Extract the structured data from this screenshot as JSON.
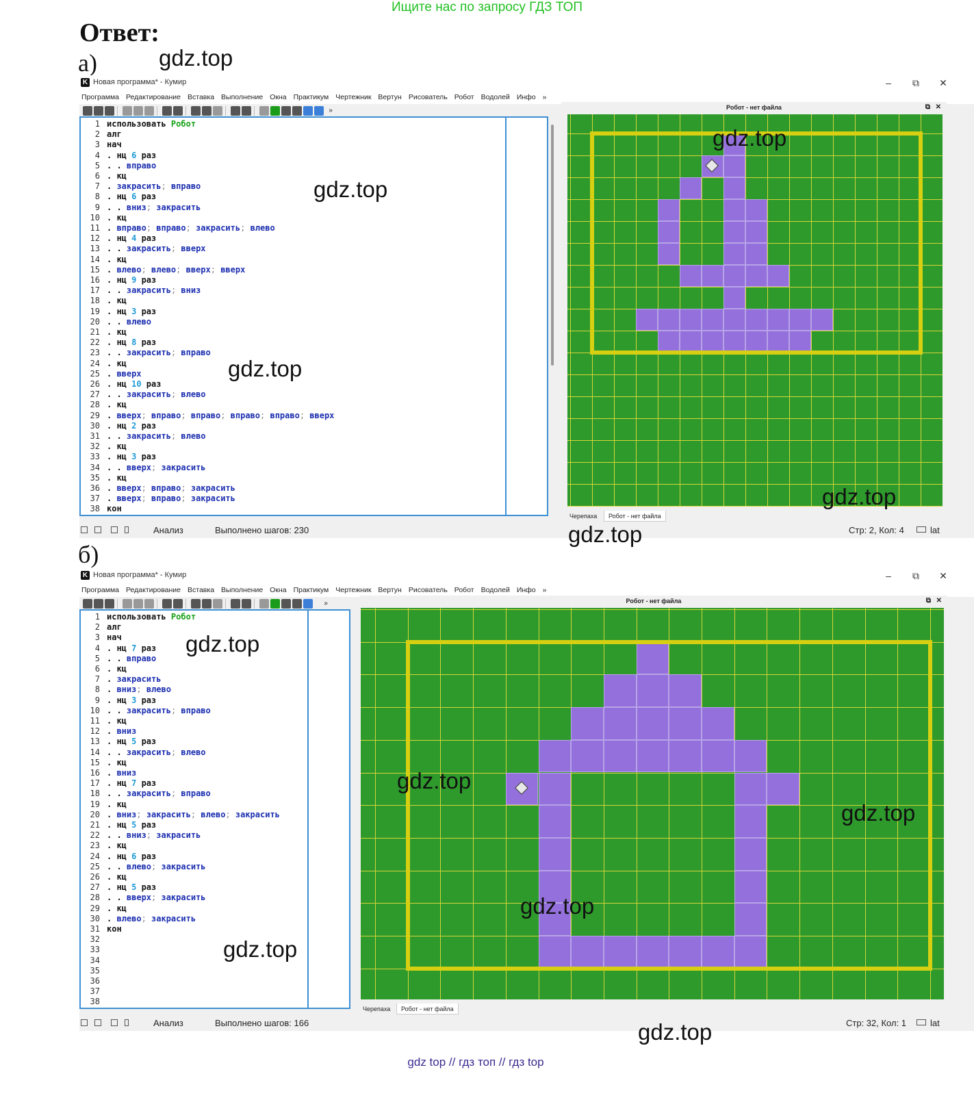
{
  "top_link": "Ищите нас по запросу ГДЗ ТОП",
  "answer_heading": "Ответ:",
  "part_a_label": "а)",
  "part_b_label": "б)",
  "watermark": "gdz.top",
  "bottom_links": "gdz top  //  гдз топ  //  гдз top",
  "window": {
    "title": "Новая программа* - Кумир",
    "controls": {
      "minimize": "–",
      "restore": "⧉",
      "close": "✕"
    },
    "menu": [
      "Программа",
      "Редактирование",
      "Вставка",
      "Выполнение",
      "Окна",
      "Практикум",
      "Чертежник",
      "Вертун",
      "Рисователь",
      "Робот",
      "Водолей",
      "Инфо",
      "»"
    ],
    "toolbar_more": "»",
    "dock_title": "Робот - нет файла",
    "dock_tabs": [
      "Черепаха",
      "Робот - нет файла"
    ],
    "dock_float": "⧉",
    "dock_close": "✕",
    "status_mode": "Анализ",
    "status_lang": "lat"
  },
  "window_a": {
    "steps": "Выполнено шагов: 230",
    "position": "Стр: 2, Кол: 4",
    "code": [
      [
        [
          "kw",
          "использовать "
        ],
        [
          "rob",
          "Робот"
        ]
      ],
      [
        [
          "kw",
          "алг"
        ]
      ],
      [
        [
          "kw",
          "нач"
        ]
      ],
      [
        [
          "kw",
          ". нц "
        ],
        [
          "num",
          "6"
        ],
        [
          "kw",
          " раз"
        ]
      ],
      [
        [
          "kw",
          ". . "
        ],
        [
          "cmd",
          "вправо"
        ]
      ],
      [
        [
          "kw",
          ". кц"
        ]
      ],
      [
        [
          "kw",
          ". "
        ],
        [
          "cmd",
          "закрасить"
        ],
        [
          "pun",
          "; "
        ],
        [
          "cmd",
          "вправо"
        ]
      ],
      [
        [
          "kw",
          ". нц "
        ],
        [
          "num",
          "6"
        ],
        [
          "kw",
          " раз"
        ]
      ],
      [
        [
          "kw",
          ". . "
        ],
        [
          "cmd",
          "вниз"
        ],
        [
          "pun",
          "; "
        ],
        [
          "cmd",
          "закрасить"
        ]
      ],
      [
        [
          "kw",
          ". кц"
        ]
      ],
      [
        [
          "kw",
          ". "
        ],
        [
          "cmd",
          "вправо"
        ],
        [
          "pun",
          "; "
        ],
        [
          "cmd",
          "вправо"
        ],
        [
          "pun",
          "; "
        ],
        [
          "cmd",
          "закрасить"
        ],
        [
          "pun",
          "; "
        ],
        [
          "cmd",
          "влево"
        ]
      ],
      [
        [
          "kw",
          ". нц "
        ],
        [
          "num",
          "4"
        ],
        [
          "kw",
          " раз"
        ]
      ],
      [
        [
          "kw",
          ". . "
        ],
        [
          "cmd",
          "закрасить"
        ],
        [
          "pun",
          "; "
        ],
        [
          "cmd",
          "вверх"
        ]
      ],
      [
        [
          "kw",
          ". кц"
        ]
      ],
      [
        [
          "kw",
          ". "
        ],
        [
          "cmd",
          "влево"
        ],
        [
          "pun",
          "; "
        ],
        [
          "cmd",
          "влево"
        ],
        [
          "pun",
          "; "
        ],
        [
          "cmd",
          "вверх"
        ],
        [
          "pun",
          "; "
        ],
        [
          "cmd",
          "вверх"
        ]
      ],
      [
        [
          "kw",
          ". нц "
        ],
        [
          "num",
          "9"
        ],
        [
          "kw",
          " раз"
        ]
      ],
      [
        [
          "kw",
          ". . "
        ],
        [
          "cmd",
          "закрасить"
        ],
        [
          "pun",
          "; "
        ],
        [
          "cmd",
          "вниз"
        ]
      ],
      [
        [
          "kw",
          ". кц"
        ]
      ],
      [
        [
          "kw",
          ". нц "
        ],
        [
          "num",
          "3"
        ],
        [
          "kw",
          " раз"
        ]
      ],
      [
        [
          "kw",
          ". . "
        ],
        [
          "cmd",
          "влево"
        ]
      ],
      [
        [
          "kw",
          ". кц"
        ]
      ],
      [
        [
          "kw",
          ". нц "
        ],
        [
          "num",
          "8"
        ],
        [
          "kw",
          " раз"
        ]
      ],
      [
        [
          "kw",
          ". . "
        ],
        [
          "cmd",
          "закрасить"
        ],
        [
          "pun",
          "; "
        ],
        [
          "cmd",
          "вправо"
        ]
      ],
      [
        [
          "kw",
          ". кц"
        ]
      ],
      [
        [
          "kw",
          ". "
        ],
        [
          "cmd",
          "вверх"
        ]
      ],
      [
        [
          "kw",
          ". нц "
        ],
        [
          "num",
          "10"
        ],
        [
          "kw",
          " раз"
        ]
      ],
      [
        [
          "kw",
          ". . "
        ],
        [
          "cmd",
          "закрасить"
        ],
        [
          "pun",
          "; "
        ],
        [
          "cmd",
          "влево"
        ]
      ],
      [
        [
          "kw",
          ". кц"
        ]
      ],
      [
        [
          "kw",
          ". "
        ],
        [
          "cmd",
          "вверх"
        ],
        [
          "pun",
          "; "
        ],
        [
          "cmd",
          "вправо"
        ],
        [
          "pun",
          "; "
        ],
        [
          "cmd",
          "вправо"
        ],
        [
          "pun",
          "; "
        ],
        [
          "cmd",
          "вправо"
        ],
        [
          "pun",
          "; "
        ],
        [
          "cmd",
          "вправо"
        ],
        [
          "pun",
          "; "
        ],
        [
          "cmd",
          "вверх"
        ]
      ],
      [
        [
          "kw",
          ". нц "
        ],
        [
          "num",
          "2"
        ],
        [
          "kw",
          " раз"
        ]
      ],
      [
        [
          "kw",
          ". . "
        ],
        [
          "cmd",
          "закрасить"
        ],
        [
          "pun",
          "; "
        ],
        [
          "cmd",
          "влево"
        ]
      ],
      [
        [
          "kw",
          ". кц"
        ]
      ],
      [
        [
          "kw",
          ". нц "
        ],
        [
          "num",
          "3"
        ],
        [
          "kw",
          " раз"
        ]
      ],
      [
        [
          "kw",
          ". . "
        ],
        [
          "cmd",
          "вверх"
        ],
        [
          "pun",
          "; "
        ],
        [
          "cmd",
          "закрасить"
        ]
      ],
      [
        [
          "kw",
          ". кц"
        ]
      ],
      [
        [
          "kw",
          ". "
        ],
        [
          "cmd",
          "вверх"
        ],
        [
          "pun",
          "; "
        ],
        [
          "cmd",
          "вправо"
        ],
        [
          "pun",
          "; "
        ],
        [
          "cmd",
          "закрасить"
        ]
      ],
      [
        [
          "kw",
          ". "
        ],
        [
          "cmd",
          "вверх"
        ],
        [
          "pun",
          "; "
        ],
        [
          "cmd",
          "вправо"
        ],
        [
          "pun",
          "; "
        ],
        [
          "cmd",
          "закрасить"
        ]
      ],
      [
        [
          "kw",
          "кон"
        ]
      ]
    ],
    "painted": [
      [
        7,
        1
      ],
      [
        6,
        2
      ],
      [
        7,
        2
      ],
      [
        5,
        3
      ],
      [
        7,
        3
      ],
      [
        4,
        4
      ],
      [
        7,
        4
      ],
      [
        8,
        4
      ],
      [
        4,
        5
      ],
      [
        7,
        5
      ],
      [
        8,
        5
      ],
      [
        4,
        6
      ],
      [
        7,
        6
      ],
      [
        8,
        6
      ],
      [
        5,
        7
      ],
      [
        6,
        7
      ],
      [
        7,
        7
      ],
      [
        8,
        7
      ],
      [
        9,
        7
      ],
      [
        7,
        8
      ],
      [
        3,
        9
      ],
      [
        4,
        9
      ],
      [
        5,
        9
      ],
      [
        6,
        9
      ],
      [
        7,
        9
      ],
      [
        8,
        9
      ],
      [
        9,
        9
      ],
      [
        10,
        9
      ],
      [
        11,
        9
      ],
      [
        4,
        10
      ],
      [
        5,
        10
      ],
      [
        6,
        10
      ],
      [
        7,
        10
      ],
      [
        8,
        10
      ],
      [
        9,
        10
      ],
      [
        10,
        10
      ]
    ],
    "robot": [
      6,
      2
    ]
  },
  "window_b": {
    "steps": "Выполнено шагов: 166",
    "position": "Стр: 32, Кол: 1",
    "code": [
      [
        [
          "kw",
          "использовать "
        ],
        [
          "rob",
          "Робот"
        ]
      ],
      [
        [
          "kw",
          "алг"
        ]
      ],
      [
        [
          "kw",
          "нач"
        ]
      ],
      [
        [
          "kw",
          ". нц "
        ],
        [
          "num",
          "7"
        ],
        [
          "kw",
          " раз"
        ]
      ],
      [
        [
          "kw",
          ". . "
        ],
        [
          "cmd",
          "вправо"
        ]
      ],
      [
        [
          "kw",
          ". кц"
        ]
      ],
      [
        [
          "kw",
          ". "
        ],
        [
          "cmd",
          "закрасить"
        ]
      ],
      [
        [
          "kw",
          ". "
        ],
        [
          "cmd",
          "вниз"
        ],
        [
          "pun",
          "; "
        ],
        [
          "cmd",
          "влево"
        ]
      ],
      [
        [
          "kw",
          ". нц "
        ],
        [
          "num",
          "3"
        ],
        [
          "kw",
          " раз"
        ]
      ],
      [
        [
          "kw",
          ". . "
        ],
        [
          "cmd",
          "закрасить"
        ],
        [
          "pun",
          "; "
        ],
        [
          "cmd",
          "вправо"
        ]
      ],
      [
        [
          "kw",
          ". кц"
        ]
      ],
      [
        [
          "kw",
          ". "
        ],
        [
          "cmd",
          "вниз"
        ]
      ],
      [
        [
          "kw",
          ". нц "
        ],
        [
          "num",
          "5"
        ],
        [
          "kw",
          " раз"
        ]
      ],
      [
        [
          "kw",
          ". . "
        ],
        [
          "cmd",
          "закрасить"
        ],
        [
          "pun",
          "; "
        ],
        [
          "cmd",
          "влево"
        ]
      ],
      [
        [
          "kw",
          ". кц"
        ]
      ],
      [
        [
          "kw",
          ". "
        ],
        [
          "cmd",
          "вниз"
        ]
      ],
      [
        [
          "kw",
          ". нц "
        ],
        [
          "num",
          "7"
        ],
        [
          "kw",
          " раз"
        ]
      ],
      [
        [
          "kw",
          ". . "
        ],
        [
          "cmd",
          "закрасить"
        ],
        [
          "pun",
          "; "
        ],
        [
          "cmd",
          "вправо"
        ]
      ],
      [
        [
          "kw",
          ". кц"
        ]
      ],
      [
        [
          "kw",
          ". "
        ],
        [
          "cmd",
          "вниз"
        ],
        [
          "pun",
          "; "
        ],
        [
          "cmd",
          "закрасить"
        ],
        [
          "pun",
          "; "
        ],
        [
          "cmd",
          "влево"
        ],
        [
          "pun",
          "; "
        ],
        [
          "cmd",
          "закрасить"
        ]
      ],
      [
        [
          "kw",
          ". нц "
        ],
        [
          "num",
          "5"
        ],
        [
          "kw",
          " раз"
        ]
      ],
      [
        [
          "kw",
          ". . "
        ],
        [
          "cmd",
          "вниз"
        ],
        [
          "pun",
          "; "
        ],
        [
          "cmd",
          "закрасить"
        ]
      ],
      [
        [
          "kw",
          ". кц"
        ]
      ],
      [
        [
          "kw",
          ". нц "
        ],
        [
          "num",
          "6"
        ],
        [
          "kw",
          " раз"
        ]
      ],
      [
        [
          "kw",
          ". . "
        ],
        [
          "cmd",
          "влево"
        ],
        [
          "pun",
          "; "
        ],
        [
          "cmd",
          "закрасить"
        ]
      ],
      [
        [
          "kw",
          ". кц"
        ]
      ],
      [
        [
          "kw",
          ". нц "
        ],
        [
          "num",
          "5"
        ],
        [
          "kw",
          " раз"
        ]
      ],
      [
        [
          "kw",
          ". . "
        ],
        [
          "cmd",
          "вверх"
        ],
        [
          "pun",
          "; "
        ],
        [
          "cmd",
          "закрасить"
        ]
      ],
      [
        [
          "kw",
          ". кц"
        ]
      ],
      [
        [
          "kw",
          ". "
        ],
        [
          "cmd",
          "влево"
        ],
        [
          "pun",
          "; "
        ],
        [
          "cmd",
          "закрасить"
        ]
      ],
      [
        [
          "kw",
          "кон"
        ]
      ],
      [],
      [],
      [],
      [],
      [],
      [],
      []
    ],
    "painted": [
      [
        8,
        1
      ],
      [
        7,
        2
      ],
      [
        8,
        2
      ],
      [
        9,
        2
      ],
      [
        6,
        3
      ],
      [
        7,
        3
      ],
      [
        8,
        3
      ],
      [
        9,
        3
      ],
      [
        10,
        3
      ],
      [
        5,
        4
      ],
      [
        6,
        4
      ],
      [
        7,
        4
      ],
      [
        8,
        4
      ],
      [
        9,
        4
      ],
      [
        10,
        4
      ],
      [
        11,
        4
      ],
      [
        4,
        5
      ],
      [
        5,
        5
      ],
      [
        11,
        5
      ],
      [
        12,
        5
      ],
      [
        5,
        6
      ],
      [
        11,
        6
      ],
      [
        5,
        7
      ],
      [
        11,
        7
      ],
      [
        5,
        8
      ],
      [
        11,
        8
      ],
      [
        5,
        9
      ],
      [
        11,
        9
      ],
      [
        5,
        10
      ],
      [
        6,
        10
      ],
      [
        7,
        10
      ],
      [
        8,
        10
      ],
      [
        9,
        10
      ],
      [
        10,
        10
      ],
      [
        11,
        10
      ]
    ],
    "robot": [
      4,
      5
    ]
  }
}
